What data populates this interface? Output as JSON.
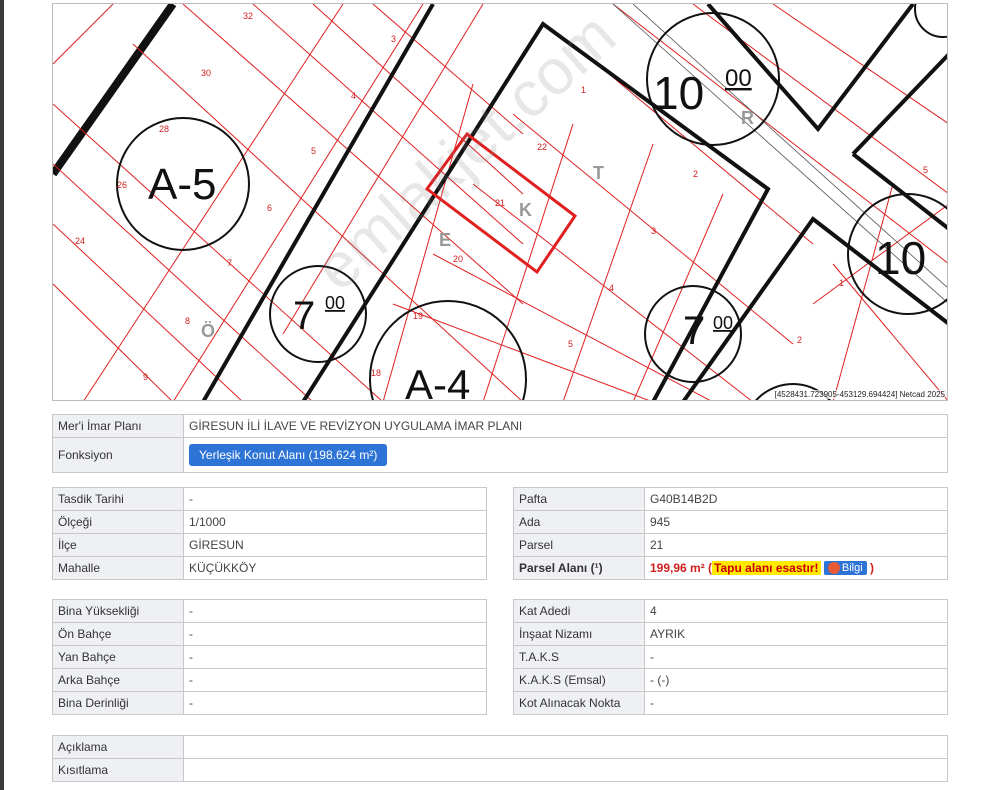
{
  "map": {
    "coordinates_label": "[4528431.723905-453129.694424] Netcad 2025",
    "zone_labels": [
      "A-5",
      "A-4"
    ],
    "height_labels": [
      "10",
      "00",
      "7",
      "00",
      "7",
      "00",
      "10"
    ],
    "street_letters": [
      "R",
      "T",
      "K",
      "E",
      "Ö"
    ],
    "parcel_numbers": [
      "32",
      "3",
      "30",
      "4",
      "28",
      "5",
      "26",
      "6",
      "24",
      "7",
      "8",
      "9",
      "1",
      "22",
      "21",
      "2",
      "20",
      "3",
      "19",
      "4",
      "18",
      "5",
      "1",
      "2",
      "5"
    ]
  },
  "plan": {
    "label": "Mer'i İmar Planı",
    "value": "GİRESUN İLİ İLAVE VE REVİZYON UYGULAMA İMAR PLANI",
    "function_label": "Fonksiyon",
    "function_value": "Yerleşik Konut Alanı (198.624 m²)"
  },
  "left1": [
    {
      "label": "Tasdik Tarihi",
      "value": "-"
    },
    {
      "label": "Ölçeği",
      "value": "1/1000"
    },
    {
      "label": "İlçe",
      "value": "GİRESUN"
    },
    {
      "label": "Mahalle",
      "value": "KÜÇÜKKÖY"
    }
  ],
  "right1": [
    {
      "label": "Pafta",
      "value": "G40B14B2D"
    },
    {
      "label": "Ada",
      "value": "945"
    },
    {
      "label": "Parsel",
      "value": "21"
    }
  ],
  "parsel_alani": {
    "label": "Parsel Alanı (¹)",
    "value": "199,96 m²",
    "open_paren": "(",
    "note": "Tapu alanı esastır!",
    "info_button": "Bilgi",
    "close_paren": ")"
  },
  "left2": [
    {
      "label": "Bina Yüksekliği",
      "value": "-"
    },
    {
      "label": "Ön Bahçe",
      "value": "-"
    },
    {
      "label": "Yan Bahçe",
      "value": "-"
    },
    {
      "label": "Arka Bahçe",
      "value": "-"
    },
    {
      "label": "Bina Derinliği",
      "value": "-"
    }
  ],
  "right2": [
    {
      "label": "Kat Adedi",
      "value": "4"
    },
    {
      "label": "İnşaat Nizamı",
      "value": "AYRIK"
    },
    {
      "label": "T.A.K.S",
      "value": "-"
    },
    {
      "label": "K.A.K.S (Emsal)",
      "value": "- (-)"
    },
    {
      "label": "Kot Alınacak Nokta",
      "value": "-"
    }
  ],
  "notes": [
    {
      "label": "Açıklama",
      "value": ""
    },
    {
      "label": "Kısıtlama",
      "value": ""
    }
  ],
  "watermark": "emlakjet.com",
  "colors": {
    "parcel_line": "#e02020",
    "block_line": "#111111",
    "button": "#2d74d6",
    "highlight": "#ffea00"
  }
}
